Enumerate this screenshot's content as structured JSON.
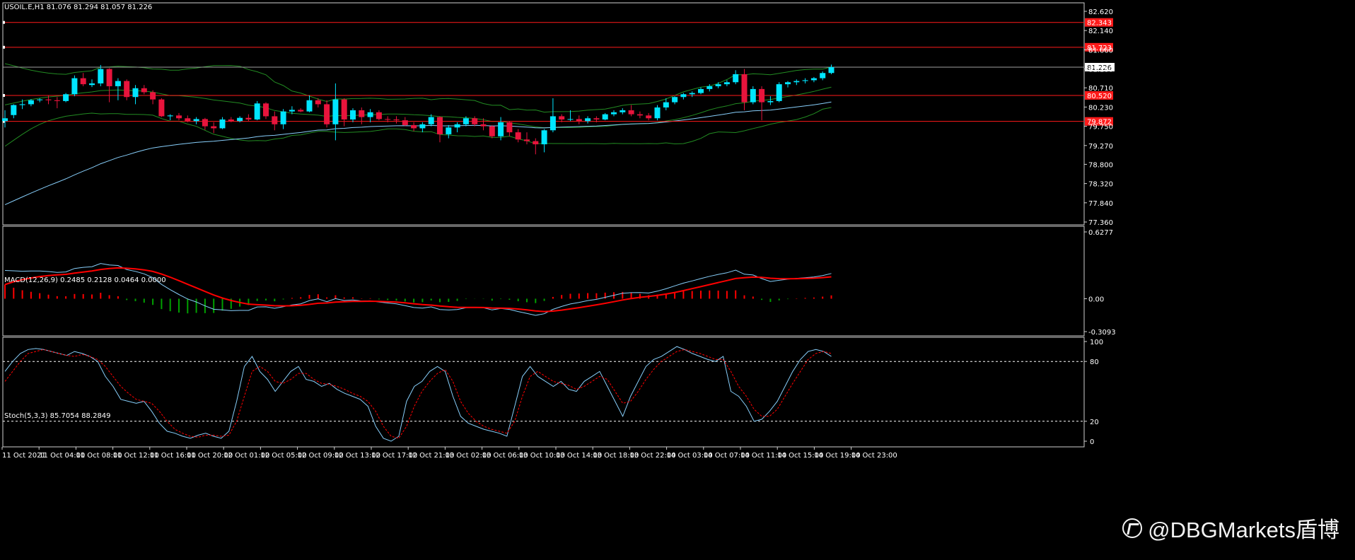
{
  "colors": {
    "background": "#000000",
    "panel_border": "#d0d0d0",
    "text": "#ffffff",
    "bull_candle": "#00e5ff",
    "bear_candle": "#e8143c",
    "level_line": "#ff1a1a",
    "bollinger": "#228b22",
    "moving_average": "#87cefa",
    "macd_main": "#87cefa",
    "macd_signal": "#ff0000",
    "macd_hist_pos": "#ff0000",
    "macd_hist_neg": "#00a000",
    "stoch_main": "#87cefa",
    "stoch_signal": "#ff0000",
    "level_dash": "#ffffff"
  },
  "watermark": {
    "text": "@DBGMarkets盾博",
    "icon": "weibo-logo-icon"
  },
  "chart_data": [
    {
      "type": "candlestick",
      "symbol_header": "USOIL.E,H1  81.076 81.294 81.057 81.226",
      "ylim": [
        77.36,
        82.62
      ],
      "y_ticks": [
        "82.620",
        "82.140",
        "81.660",
        "81.180",
        "80.710",
        "80.230",
        "79.750",
        "79.270",
        "78.800",
        "78.320",
        "77.840",
        "77.360"
      ],
      "current_price": {
        "label": "81.226",
        "value": 81.226
      },
      "levels": [
        {
          "label": "82.343",
          "value": 82.343
        },
        {
          "label": "81.723",
          "value": 81.723
        },
        {
          "label": "80.520",
          "value": 80.52
        },
        {
          "label": "79.872",
          "value": 79.872
        }
      ],
      "x_ticks": [
        "11 Oct 2021",
        "11 Oct 04:00",
        "11 Oct 08:00",
        "11 Oct 12:00",
        "11 Oct 16:00",
        "11 Oct 20:00",
        "12 Oct 01:00",
        "12 Oct 05:00",
        "12 Oct 09:00",
        "12 Oct 13:00",
        "12 Oct 17:00",
        "12 Oct 21:00",
        "13 Oct 02:00",
        "13 Oct 06:00",
        "13 Oct 10:00",
        "13 Oct 14:00",
        "13 Oct 18:00",
        "13 Oct 22:00",
        "14 Oct 03:00",
        "14 Oct 07:00",
        "14 Oct 11:00",
        "14 Oct 15:00",
        "14 Oct 19:00",
        "14 Oct 23:00"
      ],
      "candles": [
        [
          79.88,
          80.15,
          79.72,
          79.95
        ],
        [
          80.03,
          80.3,
          79.95,
          80.28
        ],
        [
          80.28,
          80.42,
          80.18,
          80.3
        ],
        [
          80.3,
          80.43,
          80.25,
          80.4
        ],
        [
          80.4,
          80.45,
          80.35,
          80.42
        ],
        [
          80.42,
          80.52,
          80.3,
          80.4
        ],
        [
          80.4,
          80.48,
          80.2,
          80.38
        ],
        [
          80.38,
          80.58,
          80.35,
          80.55
        ],
        [
          80.55,
          81.02,
          80.5,
          80.95
        ],
        [
          80.95,
          81.08,
          80.75,
          80.8
        ],
        [
          80.78,
          80.92,
          80.73,
          80.82
        ],
        [
          80.82,
          81.28,
          80.75,
          81.18
        ],
        [
          81.18,
          81.2,
          80.35,
          80.75
        ],
        [
          80.75,
          80.95,
          80.4,
          80.88
        ],
        [
          80.88,
          80.92,
          80.4,
          80.48
        ],
        [
          80.48,
          80.78,
          80.3,
          80.7
        ],
        [
          80.7,
          80.78,
          80.55,
          80.6
        ],
        [
          80.6,
          80.65,
          80.3,
          80.42
        ],
        [
          80.42,
          80.45,
          79.98,
          80.0
        ],
        [
          80.0,
          80.05,
          79.9,
          80.02
        ],
        [
          80.02,
          80.08,
          79.9,
          79.95
        ],
        [
          79.95,
          80.02,
          79.85,
          79.88
        ],
        [
          79.88,
          79.98,
          79.8,
          79.93
        ],
        [
          79.93,
          79.96,
          79.66,
          79.75
        ],
        [
          79.75,
          79.85,
          79.58,
          79.7
        ],
        [
          79.7,
          79.98,
          79.68,
          79.92
        ],
        [
          79.92,
          79.98,
          79.85,
          79.88
        ],
        [
          79.88,
          80.0,
          79.85,
          79.96
        ],
        [
          79.96,
          80.05,
          79.88,
          79.92
        ],
        [
          79.92,
          80.38,
          79.9,
          80.32
        ],
        [
          80.32,
          80.35,
          79.93,
          80.0
        ],
        [
          80.0,
          80.12,
          79.65,
          79.8
        ],
        [
          79.8,
          80.18,
          79.68,
          80.12
        ],
        [
          80.12,
          80.25,
          80.05,
          80.16
        ],
        [
          80.16,
          80.2,
          80.1,
          80.12
        ],
        [
          80.12,
          80.52,
          80.1,
          80.4
        ],
        [
          80.4,
          80.45,
          80.22,
          80.3
        ],
        [
          80.3,
          80.4,
          79.72,
          79.8
        ],
        [
          79.8,
          80.82,
          79.4,
          80.42
        ],
        [
          80.42,
          80.45,
          79.75,
          79.92
        ],
        [
          79.92,
          80.2,
          79.85,
          80.15
        ],
        [
          80.15,
          80.22,
          79.8,
          79.98
        ],
        [
          79.98,
          80.18,
          79.85,
          80.1
        ],
        [
          80.1,
          80.15,
          79.9,
          79.93
        ],
        [
          79.93,
          80.0,
          79.85,
          79.92
        ],
        [
          79.92,
          80.0,
          79.82,
          79.9
        ],
        [
          79.9,
          79.98,
          79.75,
          79.78
        ],
        [
          79.78,
          79.85,
          79.63,
          79.7
        ],
        [
          79.7,
          79.85,
          79.6,
          79.8
        ],
        [
          79.8,
          80.05,
          79.75,
          79.98
        ],
        [
          79.98,
          80.0,
          79.35,
          79.55
        ],
        [
          79.55,
          79.78,
          79.45,
          79.72
        ],
        [
          79.72,
          79.85,
          79.6,
          79.8
        ],
        [
          79.8,
          80.0,
          79.75,
          79.95
        ],
        [
          79.95,
          80.0,
          79.75,
          79.8
        ],
        [
          79.8,
          79.95,
          79.65,
          79.75
        ],
        [
          79.75,
          79.78,
          79.45,
          79.5
        ],
        [
          79.5,
          79.98,
          79.4,
          79.85
        ],
        [
          79.85,
          79.88,
          79.5,
          79.6
        ],
        [
          79.6,
          79.68,
          79.35,
          79.42
        ],
        [
          79.42,
          79.6,
          79.3,
          79.38
        ],
        [
          79.38,
          79.45,
          79.05,
          79.3
        ],
        [
          79.3,
          79.68,
          79.1,
          79.65
        ],
        [
          79.65,
          80.45,
          79.6,
          80.0
        ],
        [
          80.0,
          80.05,
          79.85,
          79.92
        ],
        [
          79.92,
          80.15,
          79.88,
          79.93
        ],
        [
          79.93,
          80.02,
          79.8,
          79.88
        ],
        [
          79.88,
          80.0,
          79.82,
          79.95
        ],
        [
          79.95,
          80.0,
          79.85,
          79.92
        ],
        [
          79.92,
          80.08,
          79.9,
          80.05
        ],
        [
          80.05,
          80.15,
          80.0,
          80.1
        ],
        [
          80.1,
          80.2,
          80.05,
          80.15
        ],
        [
          80.15,
          80.28,
          80.0,
          80.05
        ],
        [
          80.05,
          80.12,
          79.95,
          80.02
        ],
        [
          80.02,
          80.08,
          79.9,
          79.95
        ],
        [
          79.95,
          80.28,
          79.9,
          80.22
        ],
        [
          80.22,
          80.45,
          80.15,
          80.35
        ],
        [
          80.35,
          80.5,
          80.3,
          80.48
        ],
        [
          80.48,
          80.58,
          80.42,
          80.55
        ],
        [
          80.55,
          80.62,
          80.48,
          80.58
        ],
        [
          80.58,
          80.72,
          80.55,
          80.68
        ],
        [
          80.68,
          80.8,
          80.62,
          80.75
        ],
        [
          80.75,
          80.85,
          80.7,
          80.8
        ],
        [
          80.8,
          80.9,
          80.75,
          80.85
        ],
        [
          80.85,
          81.15,
          80.8,
          81.05
        ],
        [
          81.05,
          81.18,
          80.15,
          80.35
        ],
        [
          80.35,
          80.75,
          80.3,
          80.68
        ],
        [
          80.68,
          80.75,
          79.9,
          80.35
        ],
        [
          80.35,
          80.5,
          80.28,
          80.38
        ],
        [
          80.38,
          80.85,
          80.35,
          80.8
        ],
        [
          80.8,
          80.88,
          80.72,
          80.85
        ],
        [
          80.85,
          80.92,
          80.78,
          80.88
        ],
        [
          80.88,
          80.95,
          80.82,
          80.9
        ],
        [
          80.9,
          80.98,
          80.85,
          80.95
        ],
        [
          80.95,
          81.12,
          80.9,
          81.08
        ],
        [
          81.08,
          81.29,
          81.05,
          81.226
        ]
      ]
    },
    {
      "type": "macd",
      "header": "MACD(12,26,9) 0.2485 0.2128 0.0464 0.0000",
      "ylim": [
        -0.3093,
        0.6277
      ],
      "y_ticks": [
        "0.6277",
        "0.00",
        "-0.3093"
      ]
    },
    {
      "type": "stochastic",
      "header": "Stoch(5,3,3) 85.7054 88.2849",
      "ylim": [
        0,
        100
      ],
      "y_ticks": [
        "100",
        "80",
        "20",
        "0"
      ],
      "levels": [
        80,
        20
      ],
      "main": [
        70,
        80,
        88,
        92,
        93,
        92,
        90,
        88,
        86,
        90,
        88,
        85,
        80,
        65,
        55,
        42,
        40,
        38,
        40,
        30,
        18,
        10,
        8,
        5,
        3,
        6,
        8,
        5,
        3,
        10,
        40,
        75,
        85,
        70,
        62,
        50,
        60,
        70,
        75,
        62,
        60,
        55,
        58,
        52,
        48,
        45,
        42,
        35,
        15,
        3,
        0,
        5,
        40,
        55,
        60,
        70,
        75,
        70,
        45,
        25,
        18,
        15,
        12,
        10,
        8,
        5,
        35,
        65,
        75,
        65,
        60,
        55,
        60,
        52,
        50,
        60,
        65,
        70,
        55,
        40,
        25,
        45,
        60,
        75,
        82,
        85,
        90,
        95,
        92,
        88,
        85,
        82,
        80,
        85,
        50,
        45,
        35,
        20,
        22,
        30,
        40,
        55,
        70,
        82,
        90,
        92,
        90,
        85
      ],
      "signal": [
        60,
        70,
        80,
        88,
        90,
        92,
        90,
        88,
        86,
        85,
        87,
        85,
        82,
        75,
        65,
        55,
        48,
        42,
        40,
        38,
        30,
        20,
        12,
        8,
        5,
        4,
        6,
        6,
        5,
        6,
        20,
        45,
        70,
        75,
        70,
        60,
        58,
        62,
        68,
        68,
        62,
        58,
        57,
        55,
        52,
        48,
        45,
        40,
        30,
        15,
        5,
        3,
        15,
        35,
        50,
        60,
        68,
        72,
        60,
        40,
        28,
        20,
        15,
        12,
        10,
        8,
        20,
        45,
        65,
        70,
        65,
        60,
        58,
        56,
        52,
        55,
        60,
        65,
        62,
        50,
        38,
        40,
        50,
        62,
        72,
        80,
        85,
        90,
        92,
        90,
        88,
        85,
        82,
        82,
        70,
        55,
        45,
        32,
        25,
        25,
        32,
        45,
        58,
        70,
        82,
        88,
        90,
        88
      ]
    }
  ]
}
